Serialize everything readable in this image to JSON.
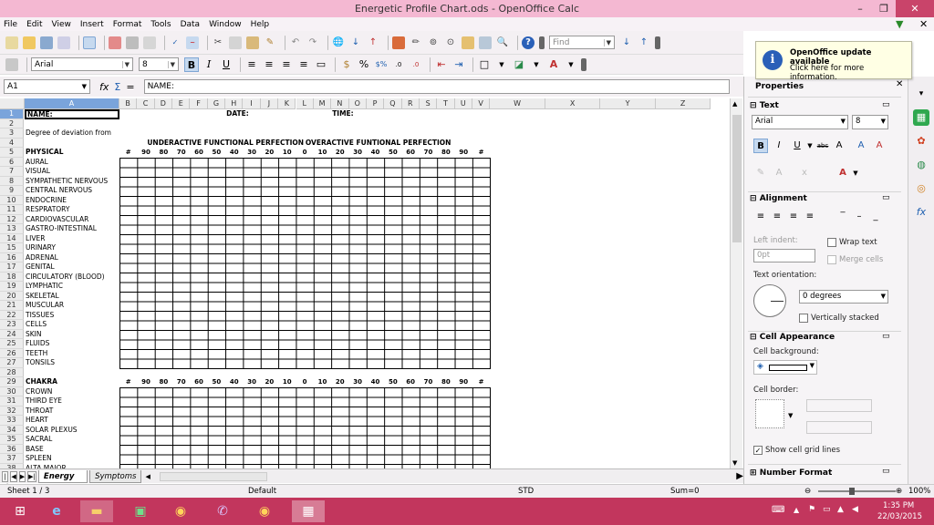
{
  "window": {
    "title": "Energetic Profile Chart.ods - OpenOffice Calc"
  },
  "menu": [
    "File",
    "Edit",
    "View",
    "Insert",
    "Format",
    "Tools",
    "Data",
    "Window",
    "Help"
  ],
  "toolbar": {
    "find_placeholder": "Find"
  },
  "format_toolbar": {
    "font_name": "Arial",
    "font_size": "8"
  },
  "formula_bar": {
    "cell_ref": "A1",
    "content": "NAME:"
  },
  "columns": [
    "A",
    "B",
    "C",
    "D",
    "E",
    "F",
    "G",
    "H",
    "I",
    "J",
    "K",
    "L",
    "M",
    "N",
    "O",
    "P",
    "Q",
    "R",
    "S",
    "T",
    "U",
    "V",
    "W",
    "X",
    "Y",
    "Z"
  ],
  "sheet": {
    "name_label": "NAME:",
    "date_label": "DATE:",
    "time_label": "TIME:",
    "deviation_label": "Degree of deviation from",
    "underactive_title": "UNDERACTIVE FUNCTIONAL PERFECTION",
    "overactive_title": "OVERACTIVE FUNTIONAL PERFECTION",
    "scale": [
      "#",
      "90",
      "80",
      "70",
      "60",
      "50",
      "40",
      "30",
      "20",
      "10",
      "0",
      "10",
      "20",
      "30",
      "40",
      "50",
      "60",
      "70",
      "80",
      "90",
      "#"
    ],
    "physical_header": "PHYSICAL",
    "physical_items": [
      "AURAL",
      "VISUAL",
      "SYMPATHETIC NERVOUS",
      "CENTRAL NERVOUS",
      "ENDOCRINE",
      "RESPRATORY",
      "CARDIOVASCULAR",
      "GASTRO-INTESTINAL",
      "LIVER",
      "URINARY",
      "ADRENAL",
      "GENITAL",
      "CIRCULATORY (BLOOD)",
      "LYMPHATIC",
      "SKELETAL",
      "MUSCULAR",
      "TISSUES",
      "CELLS",
      "SKIN",
      "FLUIDS",
      "TEETH",
      "TONSILS"
    ],
    "chakra_header": "CHAKRA",
    "chakra_items": [
      "CROWN",
      "THIRD EYE",
      "THROAT",
      "HEART",
      "SOLAR PLEXUS",
      "SACRAL",
      "BASE",
      "SPLEEN",
      "ALTA MAJOR"
    ],
    "row_numbers": [
      "1",
      "2",
      "3",
      "4",
      "5",
      "6",
      "7",
      "8",
      "9",
      "10",
      "11",
      "12",
      "13",
      "14",
      "15",
      "16",
      "17",
      "18",
      "19",
      "20",
      "21",
      "22",
      "23",
      "24",
      "25",
      "26",
      "27",
      "28",
      "29",
      "30",
      "31",
      "32",
      "33",
      "34",
      "35",
      "36",
      "37",
      "38"
    ]
  },
  "tabs": [
    "Energy Profile Chart",
    "Symptoms i"
  ],
  "status": {
    "sheet": "Sheet 1 / 3",
    "style": "Default",
    "mode": "STD",
    "sum": "Sum=0",
    "zoom": "100%"
  },
  "sidebar": {
    "title": "Properties",
    "text_section": "Text",
    "font_name": "Arial",
    "font_size": "8",
    "alignment_section": "Alignment",
    "left_indent_label": "Left indent:",
    "left_indent_value": "0pt",
    "wrap_text": "Wrap text",
    "merge_cells": "Merge cells",
    "orientation_label": "Text orientation:",
    "orientation_value": "0 degrees",
    "vertically_stacked": "Vertically stacked",
    "appearance_section": "Cell Appearance",
    "cell_background": "Cell background:",
    "cell_border": "Cell border:",
    "show_grid": "Show cell grid lines",
    "number_format_section": "Number Format"
  },
  "notification": {
    "title": "OpenOffice update available",
    "body": "Click here for more information."
  },
  "clock": {
    "time": "1:35 PM",
    "date": "22/03/2015"
  }
}
